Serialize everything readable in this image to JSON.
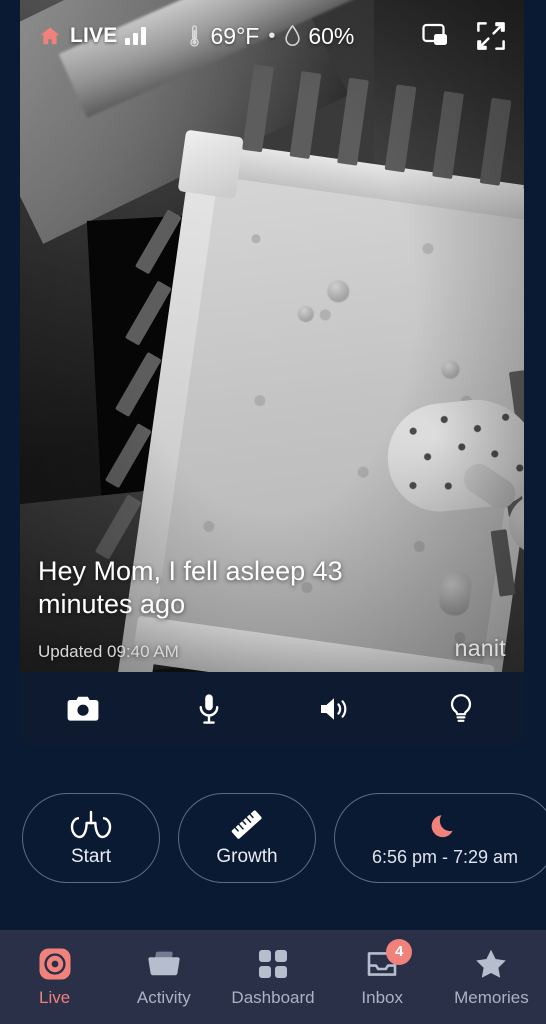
{
  "theme": {
    "background": "#0b1a33",
    "panel": "#0d1a30",
    "nav_background": "#2a3048",
    "accent": "#f0827b",
    "text_primary": "#ffffff",
    "text_muted": "#aab2c4"
  },
  "video": {
    "status": {
      "home_icon": "home-icon",
      "live_label": "LIVE",
      "signal_icon": "signal-bars-icon",
      "temperature_icon": "thermometer-icon",
      "temperature": "69°F",
      "separator": "•",
      "humidity_icon": "water-drop-icon",
      "humidity": "60%",
      "pip_icon": "picture-in-picture-icon",
      "fullscreen_icon": "fullscreen-icon"
    },
    "overlay": {
      "message": "Hey Mom, I fell asleep 43 minutes ago",
      "updated": "Updated 09:40 AM",
      "brand": "nanit"
    }
  },
  "controls": [
    {
      "name": "camera-button",
      "icon": "camera-icon"
    },
    {
      "name": "microphone-button",
      "icon": "microphone-icon"
    },
    {
      "name": "speaker-button",
      "icon": "speaker-icon"
    },
    {
      "name": "nightlight-button",
      "icon": "lightbulb-icon"
    }
  ],
  "pills": [
    {
      "name": "breathing-start-pill",
      "icon": "lungs-icon",
      "label": "Start"
    },
    {
      "name": "growth-pill",
      "icon": "ruler-icon",
      "label": "Growth"
    },
    {
      "name": "sleep-schedule-pill",
      "icon": "moon-icon",
      "label": "6:56 pm - 7:29 am"
    }
  ],
  "nav": [
    {
      "name": "nav-live",
      "icon": "live-target-icon",
      "label": "Live",
      "active": true,
      "badge": null
    },
    {
      "name": "nav-activity",
      "icon": "folder-icon",
      "label": "Activity",
      "active": false,
      "badge": null
    },
    {
      "name": "nav-dashboard",
      "icon": "grid-icon",
      "label": "Dashboard",
      "active": false,
      "badge": null
    },
    {
      "name": "nav-inbox",
      "icon": "inbox-icon",
      "label": "Inbox",
      "active": false,
      "badge": "4"
    },
    {
      "name": "nav-memories",
      "icon": "star-icon",
      "label": "Memories",
      "active": false,
      "badge": null
    }
  ]
}
